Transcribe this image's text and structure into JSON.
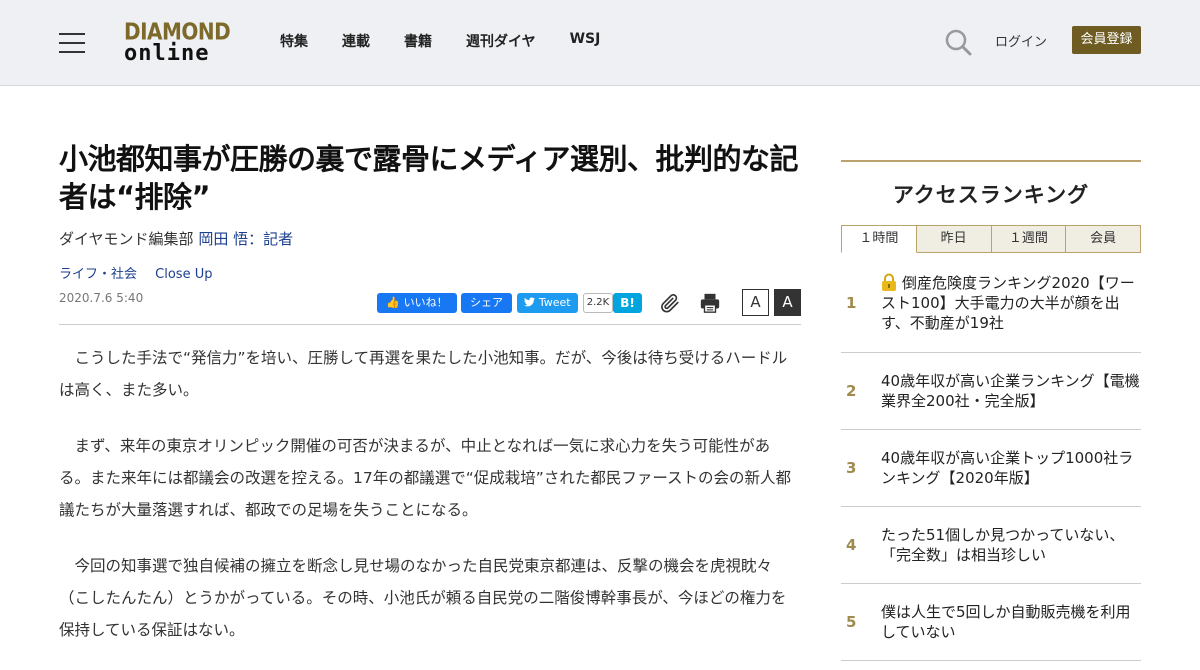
{
  "header": {
    "logo_line1": "DIAMOND",
    "logo_line2": "online",
    "nav": [
      "特集",
      "連載",
      "書籍",
      "週刊ダイヤ",
      "WSJ"
    ],
    "login": "ログイン",
    "register": "会員登録"
  },
  "article": {
    "title": "小池都知事が圧勝の裏で露骨にメディア選別、批判的な記者は“排除”",
    "byline_prefix": "ダイヤモンド編集部",
    "author": "岡田 悟：記者",
    "tags": [
      "ライフ・社会",
      "Close Up"
    ],
    "date": "2020.7.6 5:40",
    "paragraphs": [
      "こうした手法で“発信力”を培い、圧勝して再選を果たした小池知事。だが、今後は待ち受けるハードルは高く、また多い。",
      "まず、来年の東京オリンピック開催の可否が決まるが、中止となれば一気に求心力を失う可能性がある。また来年には都議会の改選を控える。17年の都議選で“促成栽培”された都民ファーストの会の新人都議たちが大量落選すれば、都政での足場を失うことになる。",
      "今回の知事選で独自候補の擁立を断念し見せ場のなかった自民党東京都連は、反撃の機会を虎視眈々（こしたんたん）とうかがっている。その時、小池氏が頼る自民党の二階俊博幹事長が、今ほどの権力を保持している保証はない。"
    ]
  },
  "share": {
    "like": "いいね！",
    "share": "シェア",
    "tweet": "Tweet",
    "hatena_count": "2.2K",
    "hatena": "B!",
    "font_small": "A",
    "font_large": "A"
  },
  "ranking": {
    "title": "アクセスランキング",
    "tabs": [
      "１時間",
      "昨日",
      "１週間",
      "会員"
    ],
    "items": [
      {
        "rank": "1",
        "text": "倒産危険度ランキング2020【ワースト100】大手電力の大半が顔を出す、不動産が19社",
        "locked": true
      },
      {
        "rank": "2",
        "text": "40歳年収が高い企業ランキング【電機業界全200社・完全版】"
      },
      {
        "rank": "3",
        "text": "40歳年収が高い企業トップ1000社ランキング【2020年版】"
      },
      {
        "rank": "4",
        "text": "たった51個しか見つかっていない、「完全数」は相当珍しい"
      },
      {
        "rank": "5",
        "text": "僕は人生で5回しか自動販売機を利用していない"
      }
    ]
  },
  "colors": {
    "brand_gold": "#6e5c22",
    "link_blue": "#1d3f8f",
    "facebook": "#1877f2",
    "twitter": "#1d9bf0",
    "hatena": "#00a4de"
  }
}
